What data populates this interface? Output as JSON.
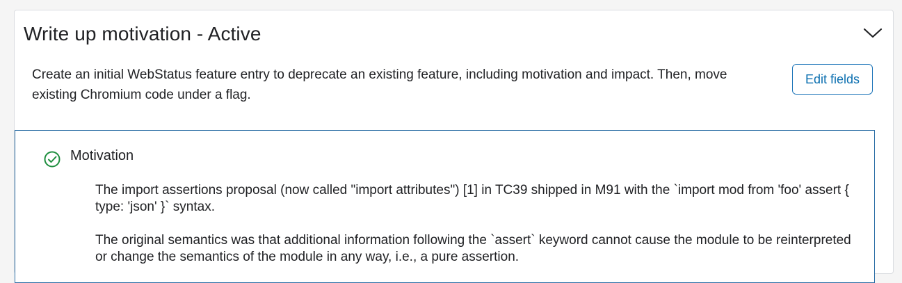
{
  "stage": {
    "title": "Write up motivation - Active",
    "description": "Create an initial WebStatus feature entry to deprecate an existing feature, including motivation and impact. Then, move existing Chromium code under a flag.",
    "edit_button_label": "Edit fields",
    "collapse_icon": "chevron-down-icon"
  },
  "section": {
    "title": "Motivation",
    "status_icon": "check-circle-icon",
    "status_color": "#1e8e3e",
    "paragraphs": [
      "The import assertions proposal (now called \"import attributes\") [1] in TC39 shipped in M91 with the `import mod from 'foo' assert { type: 'json' }` syntax.",
      "The original semantics was that additional information following the `assert` keyword cannot cause the module to be reinterpreted or change the semantics of the module in any way, i.e., a pure assertion."
    ]
  },
  "colors": {
    "accent": "#0b6fb0",
    "section_border": "#2b6ea5",
    "success": "#1e8e3e"
  }
}
